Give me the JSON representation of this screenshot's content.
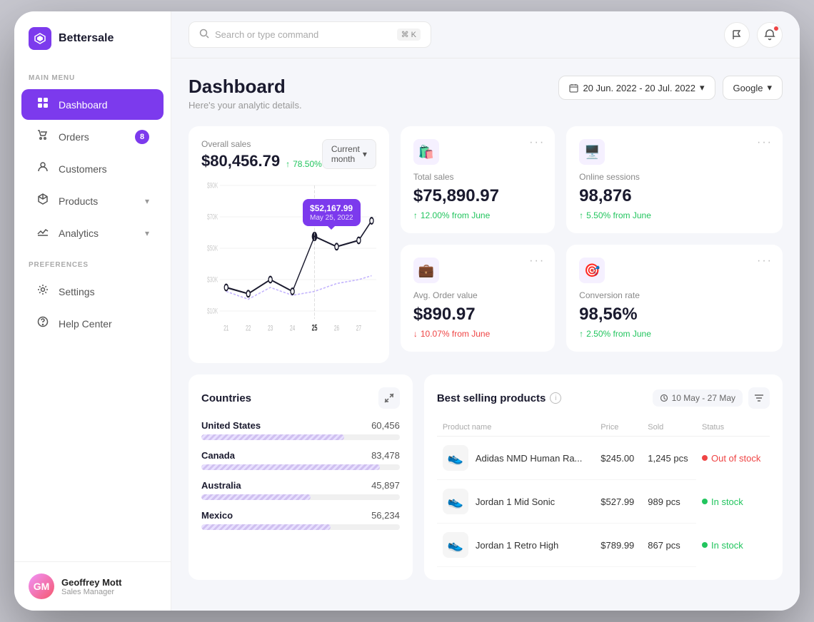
{
  "app": {
    "name": "Bettersale"
  },
  "topbar": {
    "search_placeholder": "Search or type command",
    "search_shortcut": "⌘ K"
  },
  "sidebar": {
    "section_main": "MAIN MENU",
    "section_pref": "PREFERENCES",
    "items": [
      {
        "id": "dashboard",
        "label": "Dashboard",
        "icon": "⊞",
        "active": true
      },
      {
        "id": "orders",
        "label": "Orders",
        "icon": "🛒",
        "badge": "8"
      },
      {
        "id": "customers",
        "label": "Customers",
        "icon": "👤"
      },
      {
        "id": "products",
        "label": "Products",
        "icon": "📦",
        "chevron": true
      },
      {
        "id": "analytics",
        "label": "Analytics",
        "icon": "📊",
        "chevron": true
      }
    ],
    "pref_items": [
      {
        "id": "settings",
        "label": "Settings",
        "icon": "⚙"
      },
      {
        "id": "help",
        "label": "Help Center",
        "icon": "🎧"
      }
    ],
    "user": {
      "name": "Geoffrey Mott",
      "role": "Sales Manager",
      "initials": "GM"
    }
  },
  "page": {
    "title": "Dashboard",
    "subtitle": "Here's your analytic details.",
    "date_range": "20 Jun. 2022 - 20 Jul. 2022",
    "source": "Google",
    "period_btn": "Current month"
  },
  "metrics": [
    {
      "id": "total-sales",
      "label": "Total sales",
      "value": "$75,890.97",
      "change": "12.00% from June",
      "change_type": "up",
      "icon": "🛍"
    },
    {
      "id": "online-sessions",
      "label": "Online sessions",
      "value": "98,876",
      "change": "5.50% from June",
      "change_type": "up",
      "icon": "🖥"
    },
    {
      "id": "avg-order",
      "label": "Avg. Order value",
      "value": "$890.97",
      "change": "10.07% from June",
      "change_type": "down",
      "icon": "💼"
    },
    {
      "id": "conversion",
      "label": "Conversion rate",
      "value": "98,56%",
      "change": "2.50% from June",
      "change_type": "up",
      "icon": "🎯"
    }
  ],
  "overall_sales": {
    "label": "Overall sales",
    "value": "$80,456.79",
    "change": "78.50%",
    "tooltip_value": "$52,167.99",
    "tooltip_date": "May 25, 2022",
    "y_labels": [
      "$90K",
      "$70K",
      "$50K",
      "$30K",
      "$10K"
    ],
    "x_labels": [
      "21",
      "22",
      "23",
      "24",
      "25",
      "26",
      "27"
    ]
  },
  "countries": {
    "title": "Countries",
    "items": [
      {
        "name": "United States",
        "value": "60,456",
        "pct": 72
      },
      {
        "name": "Canada",
        "value": "83,478",
        "pct": 90
      },
      {
        "name": "Australia",
        "value": "45,897",
        "pct": 55
      },
      {
        "name": "Mexico",
        "value": "56,234",
        "pct": 65
      }
    ]
  },
  "best_selling": {
    "title": "Best selling products",
    "date_range": "10 May - 27 May",
    "columns": [
      "Product name",
      "Price",
      "Sold",
      "Status"
    ],
    "products": [
      {
        "name": "Adidas NMD Human Ra...",
        "price": "$245.00",
        "sold": "1,245 pcs",
        "status": "Out of stock",
        "status_type": "out",
        "icon": "👟"
      },
      {
        "name": "Jordan 1 Mid Sonic",
        "price": "$527.99",
        "sold": "989 pcs",
        "status": "In stock",
        "status_type": "in",
        "icon": "👟"
      },
      {
        "name": "Jordan 1 Retro High",
        "price": "$789.99",
        "sold": "867 pcs",
        "status": "In stock",
        "status_type": "in",
        "icon": "👟"
      }
    ]
  }
}
